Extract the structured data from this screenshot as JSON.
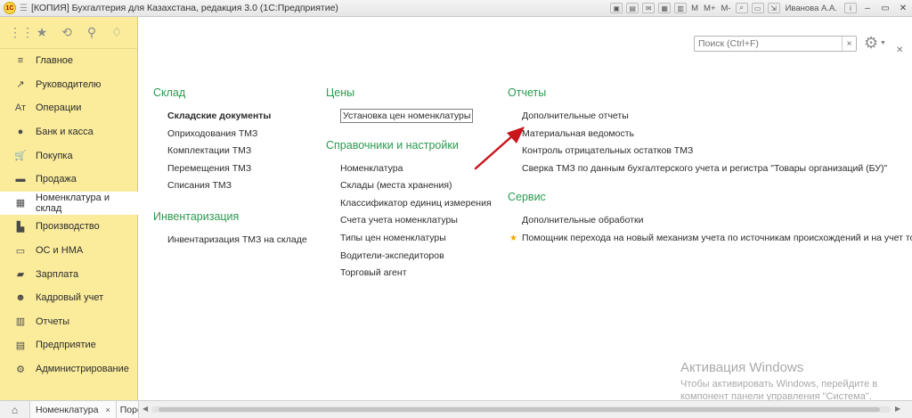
{
  "titlebar": {
    "logo": "1С",
    "title": "[КОПИЯ] Бухгалтерия для Казахстана, редакция 3.0  (1С:Предприятие)",
    "buttons": [
      "М",
      "М+",
      "М-"
    ],
    "user": "Иванова А.А.",
    "info": "i"
  },
  "sidebar": {
    "items": [
      {
        "label": "Главное",
        "icon": "≡"
      },
      {
        "label": "Руководителю",
        "icon": "↗"
      },
      {
        "label": "Операции",
        "icon": "Ат"
      },
      {
        "label": "Банк и касса",
        "icon": "●"
      },
      {
        "label": "Покупка",
        "icon": "🛒"
      },
      {
        "label": "Продажа",
        "icon": "▬"
      },
      {
        "label": "Номенклатура и склад",
        "icon": "▦",
        "active": true
      },
      {
        "label": "Производство",
        "icon": "▙"
      },
      {
        "label": "ОС и НМА",
        "icon": "▭"
      },
      {
        "label": "Зарплата",
        "icon": "▰"
      },
      {
        "label": "Кадровый учет",
        "icon": "☻"
      },
      {
        "label": "Отчеты",
        "icon": "▥"
      },
      {
        "label": "Предприятие",
        "icon": "▤"
      },
      {
        "label": "Администрирование",
        "icon": "⚙"
      }
    ]
  },
  "search": {
    "placeholder": "Поиск (Ctrl+F)",
    "clear": "×"
  },
  "sections": {
    "sklad": {
      "title": "Склад",
      "links": [
        "Складские документы",
        "Оприходования ТМЗ",
        "Комплектации ТМЗ",
        "Перемещения ТМЗ",
        "Списания ТМЗ"
      ]
    },
    "inventory": {
      "title": "Инвентаризация",
      "links": [
        "Инвентаризация ТМЗ на складе"
      ]
    },
    "prices": {
      "title": "Цены",
      "links": [
        "Установка цен номенклатуры"
      ]
    },
    "refs": {
      "title": "Справочники и настройки",
      "links": [
        "Номенклатура",
        "Склады (места хранения)",
        "Классификатор единиц измерения",
        "Счета учета номенклатуры",
        "Типы цен номенклатуры",
        "Водители-экспедиторов",
        "Торговый агент"
      ]
    },
    "reports": {
      "title": "Отчеты",
      "links": [
        "Дополнительные отчеты",
        "Материальная ведомость",
        "Контроль отрицательных остатков ТМЗ",
        "Сверка ТМЗ по данным бухгалтерского учета и регистра \"Товары организаций (БУ)\""
      ]
    },
    "service": {
      "title": "Сервис",
      "links": [
        "Дополнительные обработки",
        "Помощник перехода на новый механизм учета по источникам происхождений и на учет товаров"
      ]
    }
  },
  "watermark": {
    "title": "Активация Windows",
    "line1": "Чтобы активировать Windows, перейдите в",
    "line2": "компонент панели управления \"Система\"."
  },
  "bottombar": {
    "tabs": [
      "Номенклатура",
      "Поро"
    ],
    "close": "×"
  },
  "colors": {
    "sidebar_bg": "#fbec9c",
    "section_title": "#2a9a4f",
    "arrow": "#c8161d"
  }
}
